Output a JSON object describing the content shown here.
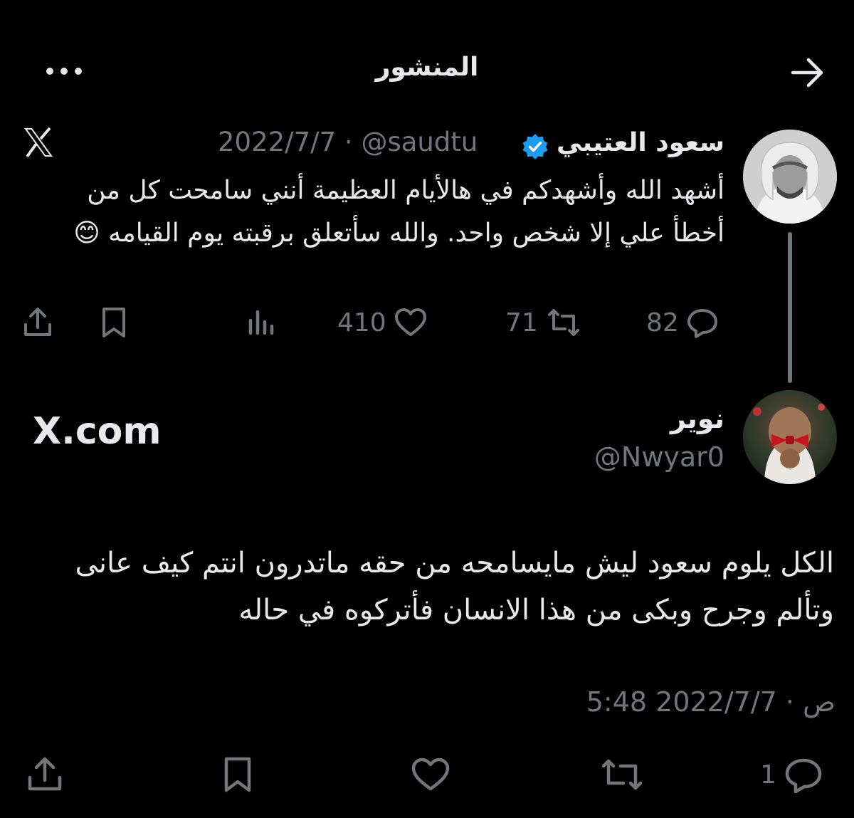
{
  "header": {
    "title": "المنشور"
  },
  "quoted": {
    "name": "سعود العتيبي",
    "handle_date": "2022/7/7 · @saudtu",
    "text": "أشهد الله وأشهدكم في هالأيام العظيمة أنني سامحت كل من أخطأ علي إلا شخص واحد. والله سأتعلق برقبته يوم القيامه 😊",
    "replies": "82",
    "reposts": "71",
    "likes": "410"
  },
  "reply": {
    "name": "نوير",
    "handle": "@Nwyar0",
    "watermark": "X.com",
    "text": "الكل يلوم سعود ليش مايسامحه من حقه ماتدرون انتم كيف عانى وتألم وجرح وبكى من هذا الانسان فأتركوه في حاله",
    "timestamp": "5:48 ص · 2022/7/7",
    "replies": "1"
  },
  "colors": {
    "background": "#000000",
    "text": "#e7e9ea",
    "muted": "#71767b",
    "verified": "#1d9bf0"
  }
}
